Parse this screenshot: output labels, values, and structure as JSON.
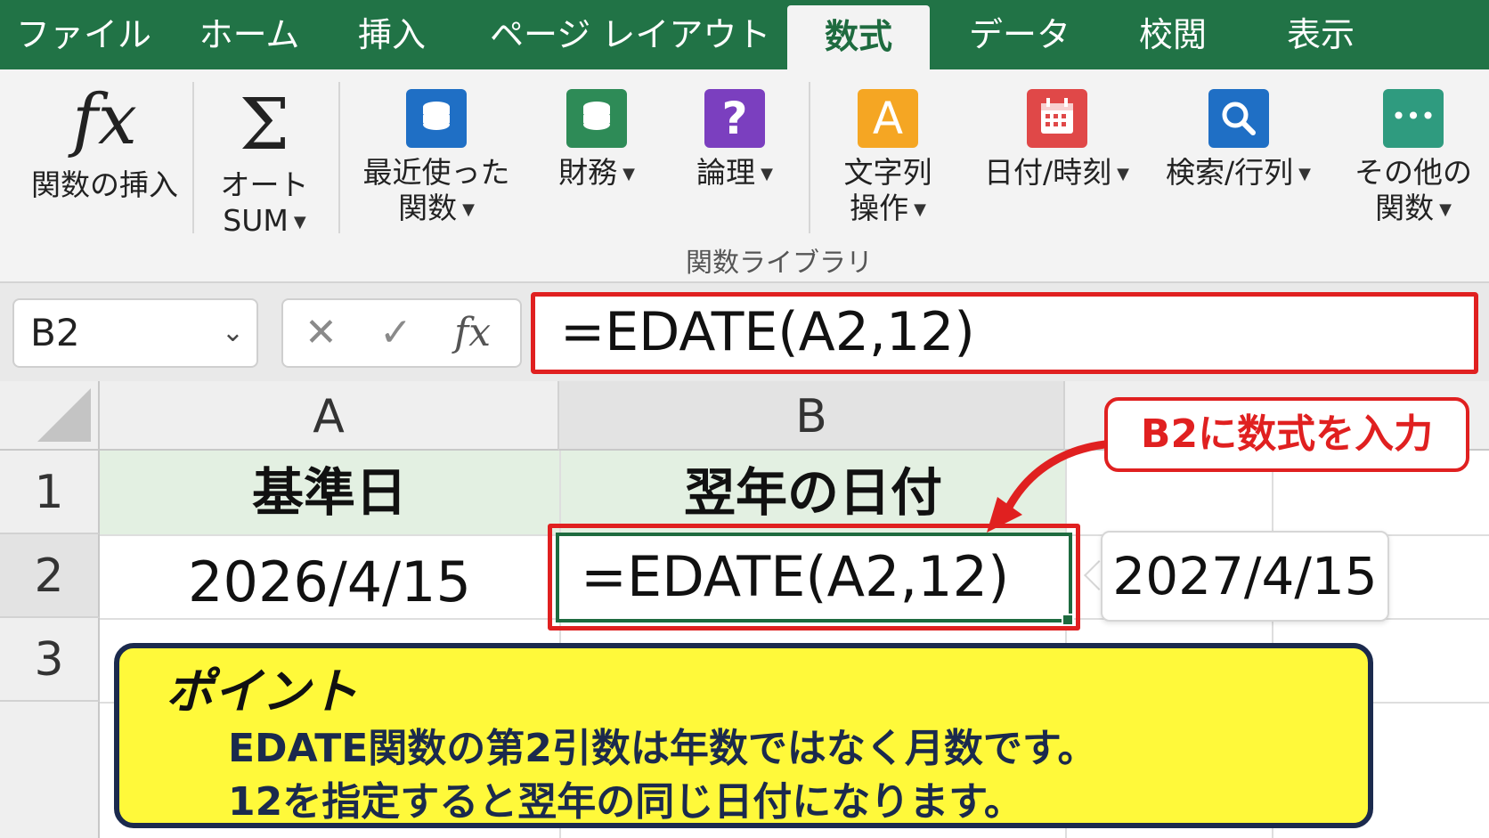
{
  "tabs": [
    "ファイル",
    "ホーム",
    "挿入",
    "ページ レイアウト",
    "数式",
    "データ",
    "校閲",
    "表示"
  ],
  "active_tab": "数式",
  "ribbon": {
    "insert_function": {
      "icon_text": "fx",
      "label": "関数の挿入"
    },
    "autosum": {
      "icon_text": "Σ",
      "label_line1": "オート",
      "label_line2": "SUM"
    },
    "recent": {
      "label_line1": "最近使った",
      "label_line2": "関数"
    },
    "financial": {
      "label": "財務"
    },
    "logical": {
      "icon_text": "?",
      "label": "論理"
    },
    "text": {
      "icon_text": "A",
      "label_line1": "文字列",
      "label_line2": "操作"
    },
    "datetime": {
      "label": "日付/時刻"
    },
    "lookup": {
      "label": "検索/行列"
    },
    "more": {
      "icon_text": "•••",
      "label_line1": "その他の",
      "label_line2": "関数"
    },
    "group_label": "関数ライブラリ",
    "dropdown_arrow": "▼"
  },
  "colors": {
    "excel_green": "#217346",
    "recent_icon": "#1f6fc5",
    "financial_icon": "#2e8b57",
    "logical_icon": "#7b3fbf",
    "text_icon": "#f5a623",
    "datetime_icon": "#e04848",
    "lookup_icon": "#1f6fc5",
    "more_icon": "#2f9b7f",
    "highlight_red": "#e02020",
    "point_yellow": "#fff93a"
  },
  "formula_bar": {
    "name_box": "B2",
    "name_box_chevron": "⌄",
    "cancel": "✕",
    "enter": "✓",
    "fx": "fx",
    "formula": "=EDATE(A2,12)"
  },
  "grid": {
    "columns": [
      "A",
      "B"
    ],
    "rows": [
      "1",
      "2",
      "3"
    ],
    "a1": "基準日",
    "b1": "翌年の日付",
    "a2": "2026/4/15",
    "b2": "=EDATE(A2,12)"
  },
  "callout": {
    "label": "B2に数式を入力"
  },
  "result": {
    "value": "2027/4/15"
  },
  "point": {
    "title": "ポイント",
    "line1": "EDATE関数の第2引数は年数ではなく月数です。",
    "line2": "12を指定すると翌年の同じ日付になります。"
  }
}
